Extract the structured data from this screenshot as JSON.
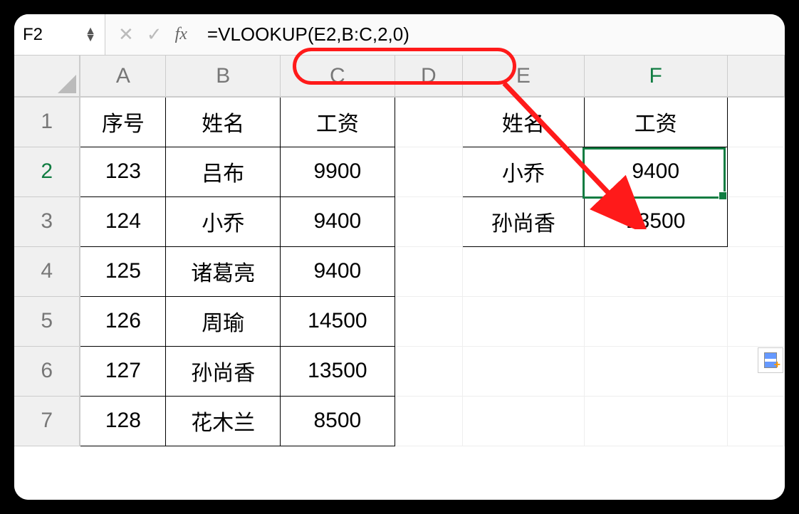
{
  "formula_bar": {
    "cell_ref": "F2",
    "fx_label": "fx",
    "formula": "=VLOOKUP(E2,B:C,2,0)"
  },
  "columns": [
    "A",
    "B",
    "C",
    "D",
    "E",
    "F"
  ],
  "active_col": "F",
  "active_row": "2",
  "rows": [
    "1",
    "2",
    "3",
    "4",
    "5",
    "6",
    "7"
  ],
  "cells": {
    "r1": {
      "A": "序号",
      "B": "姓名",
      "C": "工资",
      "D": "",
      "E": "姓名",
      "F": "工资"
    },
    "r2": {
      "A": "123",
      "B": "吕布",
      "C": "9900",
      "D": "",
      "E": "小乔",
      "F": "9400"
    },
    "r3": {
      "A": "124",
      "B": "小乔",
      "C": "9400",
      "D": "",
      "E": "孙尚香",
      "F": "13500"
    },
    "r4": {
      "A": "125",
      "B": "诸葛亮",
      "C": "9400",
      "D": "",
      "E": "",
      "F": ""
    },
    "r5": {
      "A": "126",
      "B": "周瑜",
      "C": "14500",
      "D": "",
      "E": "",
      "F": ""
    },
    "r6": {
      "A": "127",
      "B": "孙尚香",
      "C": "13500",
      "D": "",
      "E": "",
      "F": ""
    },
    "r7": {
      "A": "128",
      "B": "花木兰",
      "C": "8500",
      "D": "",
      "E": "",
      "F": ""
    }
  },
  "selected_cell": "F2"
}
